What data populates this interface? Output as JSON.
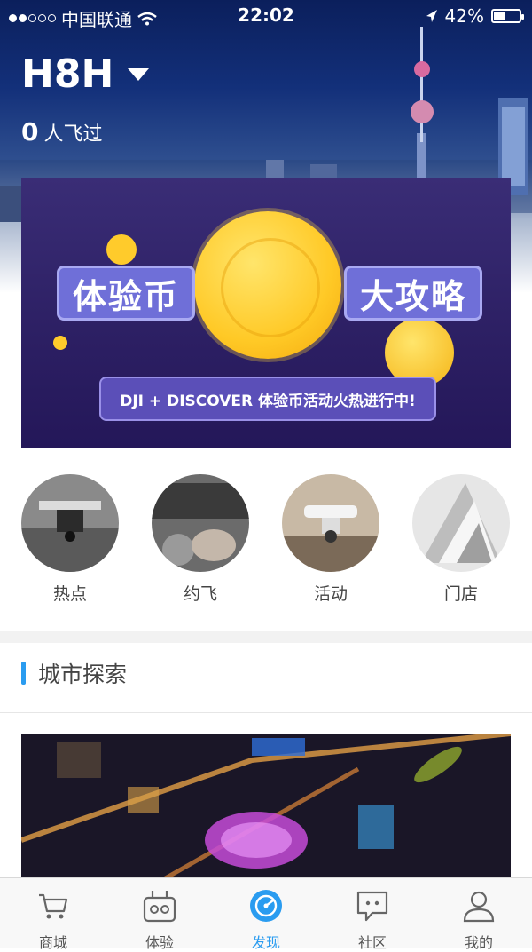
{
  "status_bar": {
    "carrier": "中国联通",
    "time": "22:02",
    "battery": "42%",
    "battery_level": 0.42
  },
  "header": {
    "title": "H8H",
    "flown_count": "0",
    "flown_label": "人飞过"
  },
  "banner": {
    "left_tag": "体验币",
    "right_tag": "大攻略",
    "caption": "DJI + DISCOVER  体验币活动火热进行中!"
  },
  "categories": [
    {
      "label": "热点",
      "icon": "drone-photo"
    },
    {
      "label": "约飞",
      "icon": "hands-drone-photo"
    },
    {
      "label": "活动",
      "icon": "phantom-drone-photo"
    },
    {
      "label": "门店",
      "icon": "architecture-photo"
    }
  ],
  "section": {
    "title": "城市探索"
  },
  "tabbar": {
    "items": [
      {
        "label": "商城",
        "icon": "cart-icon"
      },
      {
        "label": "体验",
        "icon": "controller-icon"
      },
      {
        "label": "发现",
        "icon": "compass-icon"
      },
      {
        "label": "社区",
        "icon": "chat-icon"
      },
      {
        "label": "我的",
        "icon": "user-icon"
      }
    ],
    "active_index": 2,
    "active_color": "#2a9cf0"
  }
}
